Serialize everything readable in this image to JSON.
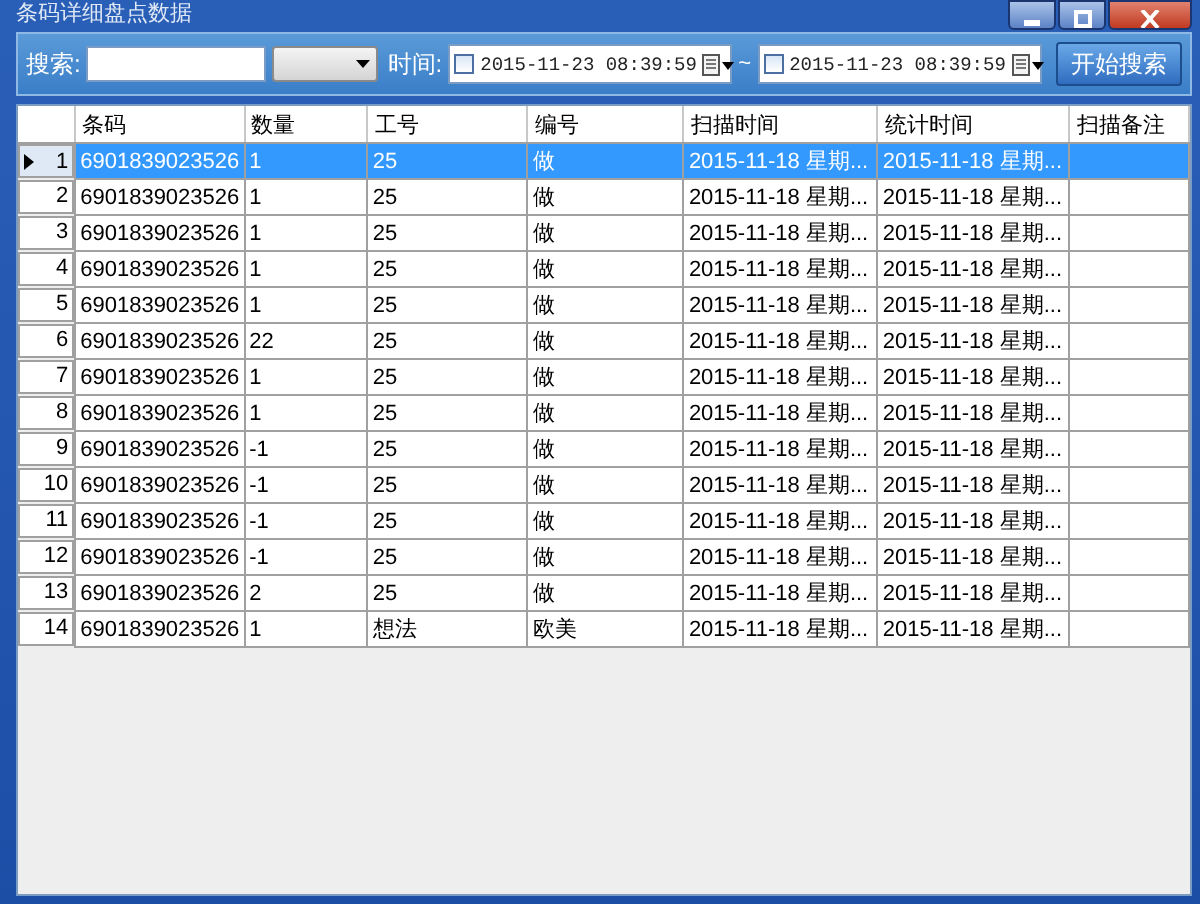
{
  "window": {
    "title": "条码详细盘点数据"
  },
  "toolbar": {
    "search_label": "搜索:",
    "time_label": "时间:",
    "date_from": {
      "value": "2015-11-23 08:39:59",
      "checked": false
    },
    "separator": "~",
    "date_to": {
      "value": "2015-11-23 08:39:59",
      "checked": false
    },
    "search_button": "开始搜索"
  },
  "table": {
    "columns": [
      "条码",
      "数量",
      "工号",
      "编号",
      "扫描时间",
      "统计时间",
      "扫描备注"
    ],
    "rows": [
      {
        "index": "1",
        "selected": true,
        "cells": [
          "6901839023526",
          "1",
          "25",
          "做",
          "2015-11-18 星期...",
          "2015-11-18 星期..."
        ]
      },
      {
        "index": "2",
        "selected": false,
        "cells": [
          "6901839023526",
          "1",
          "25",
          "做",
          "2015-11-18 星期...",
          "2015-11-18 星期..."
        ]
      },
      {
        "index": "3",
        "selected": false,
        "cells": [
          "6901839023526",
          "1",
          "25",
          "做",
          "2015-11-18 星期...",
          "2015-11-18 星期..."
        ]
      },
      {
        "index": "4",
        "selected": false,
        "cells": [
          "6901839023526",
          "1",
          "25",
          "做",
          "2015-11-18 星期...",
          "2015-11-18 星期..."
        ]
      },
      {
        "index": "5",
        "selected": false,
        "cells": [
          "6901839023526",
          "1",
          "25",
          "做",
          "2015-11-18 星期...",
          "2015-11-18 星期..."
        ]
      },
      {
        "index": "6",
        "selected": false,
        "cells": [
          "6901839023526",
          "22",
          "25",
          "做",
          "2015-11-18 星期...",
          "2015-11-18 星期..."
        ]
      },
      {
        "index": "7",
        "selected": false,
        "cells": [
          "6901839023526",
          "1",
          "25",
          "做",
          "2015-11-18 星期...",
          "2015-11-18 星期..."
        ]
      },
      {
        "index": "8",
        "selected": false,
        "cells": [
          "6901839023526",
          "1",
          "25",
          "做",
          "2015-11-18 星期...",
          "2015-11-18 星期..."
        ]
      },
      {
        "index": "9",
        "selected": false,
        "cells": [
          "6901839023526",
          "-1",
          "25",
          "做",
          "2015-11-18 星期...",
          "2015-11-18 星期..."
        ]
      },
      {
        "index": "10",
        "selected": false,
        "cells": [
          "6901839023526",
          "-1",
          "25",
          "做",
          "2015-11-18 星期...",
          "2015-11-18 星期..."
        ]
      },
      {
        "index": "11",
        "selected": false,
        "cells": [
          "6901839023526",
          "-1",
          "25",
          "做",
          "2015-11-18 星期...",
          "2015-11-18 星期..."
        ]
      },
      {
        "index": "12",
        "selected": false,
        "cells": [
          "6901839023526",
          "-1",
          "25",
          "做",
          "2015-11-18 星期...",
          "2015-11-18 星期..."
        ]
      },
      {
        "index": "13",
        "selected": false,
        "cells": [
          "6901839023526",
          "2",
          "25",
          "做",
          "2015-11-18 星期...",
          "2015-11-18 星期..."
        ]
      },
      {
        "index": "14",
        "selected": false,
        "cells": [
          "6901839023526",
          "1",
          "想法",
          "欧美",
          "2015-11-18 星期...",
          "2015-11-18 星期..."
        ]
      }
    ]
  }
}
